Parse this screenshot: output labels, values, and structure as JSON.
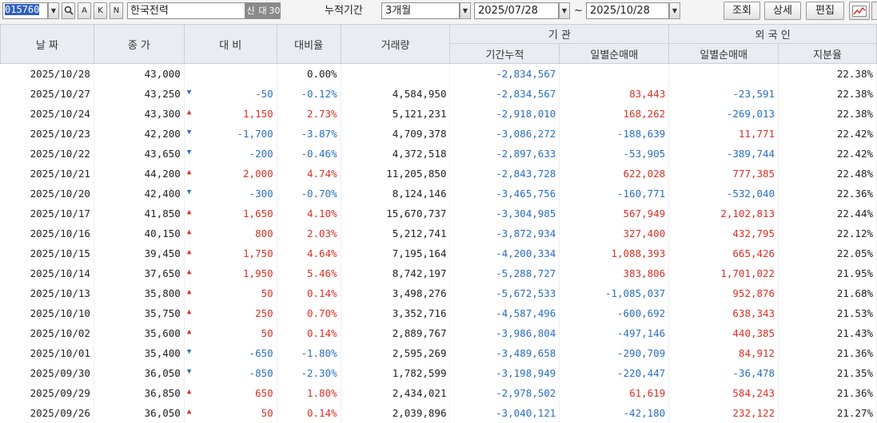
{
  "toolbar": {
    "code_value": "015760",
    "icon_a": "A",
    "icon_k": "K",
    "icon_n": "N",
    "stock_name": "한국전력",
    "tag_credit": "신",
    "tag_loan": "대",
    "tag_days": "30",
    "period_label": "누적기간",
    "period_value": "3개월",
    "start_date": "2025/07/28",
    "range_sep": "~",
    "end_date": "2025/10/28",
    "btn_search": "조회",
    "btn_detail": "상세",
    "btn_edit": "편집"
  },
  "headers": {
    "date": "날 짜",
    "close": "종 가",
    "change": "대 비",
    "rate": "대비율",
    "volume": "거래량",
    "inst_group": "기   관",
    "inst_cum": "기간누적",
    "inst_daily": "일별순매매",
    "foreign_group": "외 국 인",
    "foreign_daily": "일별순매매",
    "foreign_share": "지분율"
  },
  "rows": [
    {
      "date": "2025/10/28",
      "close": "43,000",
      "dir": "",
      "change": "",
      "rate": "0.00%",
      "volume": "",
      "inst_cum": "-2,834,567",
      "inst_daily": "",
      "for_daily": "",
      "share": "22.38%"
    },
    {
      "date": "2025/10/27",
      "close": "43,250",
      "dir": "down",
      "change": "-50",
      "rate": "-0.12%",
      "volume": "4,584,950",
      "inst_cum": "-2,834,567",
      "inst_daily": "83,443",
      "for_daily": "-23,591",
      "share": "22.38%"
    },
    {
      "date": "2025/10/24",
      "close": "43,300",
      "dir": "up",
      "change": "1,150",
      "rate": "2.73%",
      "volume": "5,121,231",
      "inst_cum": "-2,918,010",
      "inst_daily": "168,262",
      "for_daily": "-269,013",
      "share": "22.38%"
    },
    {
      "date": "2025/10/23",
      "close": "42,200",
      "dir": "down",
      "change": "-1,700",
      "rate": "-3.87%",
      "volume": "4,709,378",
      "inst_cum": "-3,086,272",
      "inst_daily": "-188,639",
      "for_daily": "11,771",
      "share": "22.42%"
    },
    {
      "date": "2025/10/22",
      "close": "43,650",
      "dir": "down",
      "change": "-200",
      "rate": "-0.46%",
      "volume": "4,372,518",
      "inst_cum": "-2,897,633",
      "inst_daily": "-53,905",
      "for_daily": "-389,744",
      "share": "22.42%"
    },
    {
      "date": "2025/10/21",
      "close": "44,200",
      "dir": "up",
      "change": "2,000",
      "rate": "4.74%",
      "volume": "11,205,850",
      "inst_cum": "-2,843,728",
      "inst_daily": "622,028",
      "for_daily": "777,385",
      "share": "22.48%"
    },
    {
      "date": "2025/10/20",
      "close": "42,400",
      "dir": "down",
      "change": "-300",
      "rate": "-0.70%",
      "volume": "8,124,146",
      "inst_cum": "-3,465,756",
      "inst_daily": "-160,771",
      "for_daily": "-532,040",
      "share": "22.36%"
    },
    {
      "date": "2025/10/17",
      "close": "41,850",
      "dir": "up",
      "change": "1,650",
      "rate": "4.10%",
      "volume": "15,670,737",
      "inst_cum": "-3,304,985",
      "inst_daily": "567,949",
      "for_daily": "2,102,813",
      "share": "22.44%"
    },
    {
      "date": "2025/10/16",
      "close": "40,150",
      "dir": "up",
      "change": "800",
      "rate": "2.03%",
      "volume": "5,212,741",
      "inst_cum": "-3,872,934",
      "inst_daily": "327,400",
      "for_daily": "432,795",
      "share": "22.12%"
    },
    {
      "date": "2025/10/15",
      "close": "39,450",
      "dir": "up",
      "change": "1,750",
      "rate": "4.64%",
      "volume": "7,195,164",
      "inst_cum": "-4,200,334",
      "inst_daily": "1,088,393",
      "for_daily": "665,426",
      "share": "22.05%"
    },
    {
      "date": "2025/10/14",
      "close": "37,650",
      "dir": "up",
      "change": "1,950",
      "rate": "5.46%",
      "volume": "8,742,197",
      "inst_cum": "-5,288,727",
      "inst_daily": "383,806",
      "for_daily": "1,701,022",
      "share": "21.95%"
    },
    {
      "date": "2025/10/13",
      "close": "35,800",
      "dir": "up",
      "change": "50",
      "rate": "0.14%",
      "volume": "3,498,276",
      "inst_cum": "-5,672,533",
      "inst_daily": "-1,085,037",
      "for_daily": "952,876",
      "share": "21.68%"
    },
    {
      "date": "2025/10/10",
      "close": "35,750",
      "dir": "up",
      "change": "250",
      "rate": "0.70%",
      "volume": "3,352,716",
      "inst_cum": "-4,587,496",
      "inst_daily": "-600,692",
      "for_daily": "638,343",
      "share": "21.53%"
    },
    {
      "date": "2025/10/02",
      "close": "35,600",
      "dir": "up",
      "change": "50",
      "rate": "0.14%",
      "volume": "2,889,767",
      "inst_cum": "-3,986,804",
      "inst_daily": "-497,146",
      "for_daily": "440,385",
      "share": "21.43%"
    },
    {
      "date": "2025/10/01",
      "close": "35,400",
      "dir": "down",
      "change": "-650",
      "rate": "-1.80%",
      "volume": "2,595,269",
      "inst_cum": "-3,489,658",
      "inst_daily": "-290,709",
      "for_daily": "84,912",
      "share": "21.36%"
    },
    {
      "date": "2025/09/30",
      "close": "36,050",
      "dir": "down",
      "change": "-850",
      "rate": "-2.30%",
      "volume": "1,782,599",
      "inst_cum": "-3,198,949",
      "inst_daily": "-220,447",
      "for_daily": "-36,478",
      "share": "21.35%"
    },
    {
      "date": "2025/09/29",
      "close": "36,850",
      "dir": "up",
      "change": "650",
      "rate": "1.80%",
      "volume": "2,434,021",
      "inst_cum": "-2,978,502",
      "inst_daily": "61,619",
      "for_daily": "584,243",
      "share": "21.36%"
    },
    {
      "date": "2025/09/26",
      "close": "36,050",
      "dir": "up",
      "change": "50",
      "rate": "0.14%",
      "volume": "2,039,896",
      "inst_cum": "-3,040,121",
      "inst_daily": "-42,180",
      "for_daily": "232,122",
      "share": "21.27%"
    }
  ],
  "colors": {
    "up": "#d93025",
    "down": "#2a6fbf",
    "header_bg": "#e9ecf2"
  },
  "icons": {
    "search": "magnifier-icon",
    "chart": "line-chart-icon",
    "dropdown": "chevron-down-icon"
  }
}
